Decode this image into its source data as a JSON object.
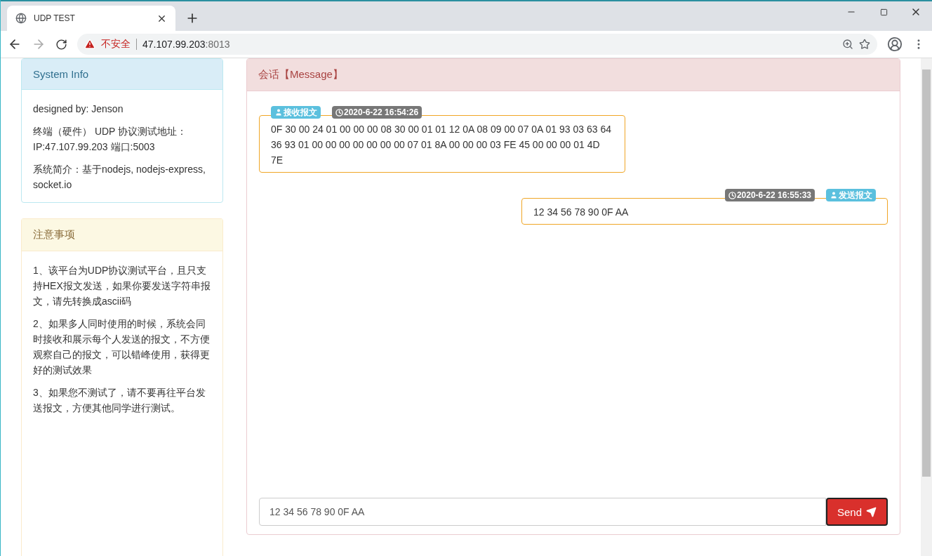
{
  "browser": {
    "tab_title": "UDP TEST",
    "security_label": "不安全",
    "url_host": "47.107.99.203",
    "url_port": ":8013"
  },
  "system_info": {
    "title": "System Info",
    "paragraphs": [
      "designed by: Jenson",
      "终端（硬件） UDP 协议测试地址：IP:47.107.99.203 端口:5003",
      "系统简介：基于nodejs, nodejs-express, socket.io"
    ]
  },
  "notes": {
    "title": "注意事项",
    "paragraphs": [
      "1、该平台为UDP协议测试平台，且只支持HEX报文发送，如果你要发送字符串报文，请先转换成ascii码",
      "2、如果多人同时使用的时候，系统会同时接收和展示每个人发送的报文，不方便观察自己的报文，可以错峰使用，获得更好的测试效果",
      "3、如果您不测试了，请不要再往平台发送报文，方便其他同学进行测试。"
    ]
  },
  "conversation": {
    "title": "会话【Message】",
    "messages": [
      {
        "kind": "received",
        "label": "接收报文",
        "time": "2020-6-22 16:54:26",
        "body": "0F 30 00 24 01 00 00 00 08 30 00 01 01 12 0A 08 09 00 07 0A 01 93 03 63 64 36 93 01 00 00 00 00 00 00 00 07 01 8A 00 00 00 03 FE 45 00 00 00 01 4D 7E"
      },
      {
        "kind": "sent",
        "label": "发送报文",
        "time": "2020-6-22 16:55:33",
        "body": "12 34 56 78 90 0F AA"
      }
    ],
    "input_value": "12 34 56 78 90 0F AA",
    "send_label": "Send"
  }
}
